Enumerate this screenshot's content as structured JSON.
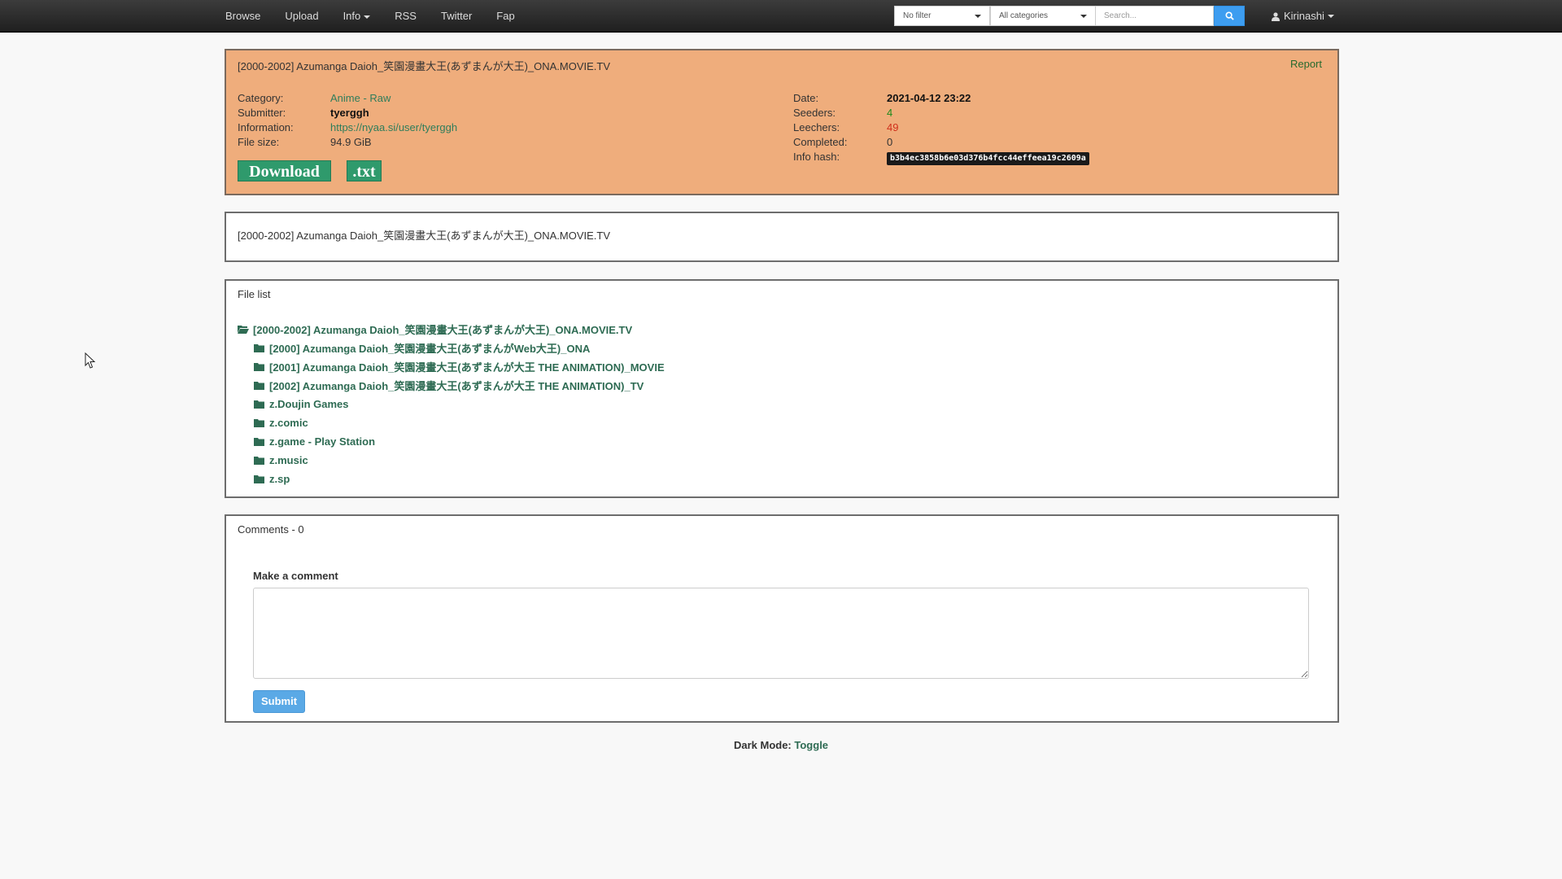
{
  "nav": {
    "items": [
      {
        "label": "Browse"
      },
      {
        "label": "Upload"
      },
      {
        "label": "Info",
        "dropdown": true
      },
      {
        "label": "RSS"
      },
      {
        "label": "Twitter"
      },
      {
        "label": "Fap"
      }
    ],
    "filter_value": "No filter",
    "category_value": "All categories",
    "search_placeholder": "Search...",
    "search_icon": "search-icon",
    "user_name": "Kirinashi",
    "user_icon": "user-icon"
  },
  "torrent": {
    "title": "[2000-2002] Azumanga Daioh_笑園漫畫大王(あずまんが大王)_ONA.MOVIE.TV",
    "report_label": "Report",
    "labels": {
      "category": "Category:",
      "submitter": "Submitter:",
      "information": "Information:",
      "file_size": "File size:",
      "date": "Date:",
      "seeders": "Seeders:",
      "leechers": "Leechers:",
      "completed": "Completed:",
      "info_hash": "Info hash:"
    },
    "category": "Anime - Raw",
    "submitter": "tyerggh",
    "information": "https://nyaa.si/user/tyerggh",
    "file_size": "94.9 GiB",
    "date": "2021-04-12 23:22",
    "seeders": "4",
    "leechers": "49",
    "completed": "0",
    "info_hash": "b3b4ec3858b6e03d376b4fcc44effeea19c2609a",
    "download_label": "Download",
    "txt_label": ".txt",
    "colors": {
      "panel": "#efad7c",
      "seeders": "#1c8a1c",
      "leechers": "#d0301c"
    }
  },
  "description": {
    "text": "[2000-2002] Azumanga Daioh_笑園漫畫大王(あずまんが大王)_ONA.MOVIE.TV"
  },
  "file_list": {
    "header": "File list",
    "root": "[2000-2002] Azumanga Daioh_笑園漫畫大王(あずまんが大王)_ONA.MOVIE.TV",
    "children": [
      "[2000] Azumanga Daioh_笑園漫畫大王(あずまんがWeb大王)_ONA",
      "[2001] Azumanga Daioh_笑園漫畫大王(あずまんが大王 THE ANIMATION)_MOVIE",
      "[2002] Azumanga Daioh_笑園漫畫大王(あずまんが大王 THE ANIMATION)_TV",
      "z.Doujin Games",
      "z.comic",
      "z.game - Play Station",
      "z.music",
      "z.sp"
    ]
  },
  "comments": {
    "header": "Comments - 0",
    "make_label": "Make a comment",
    "submit_label": "Submit"
  },
  "footer": {
    "label": "Dark Mode:",
    "toggle": "Toggle"
  }
}
